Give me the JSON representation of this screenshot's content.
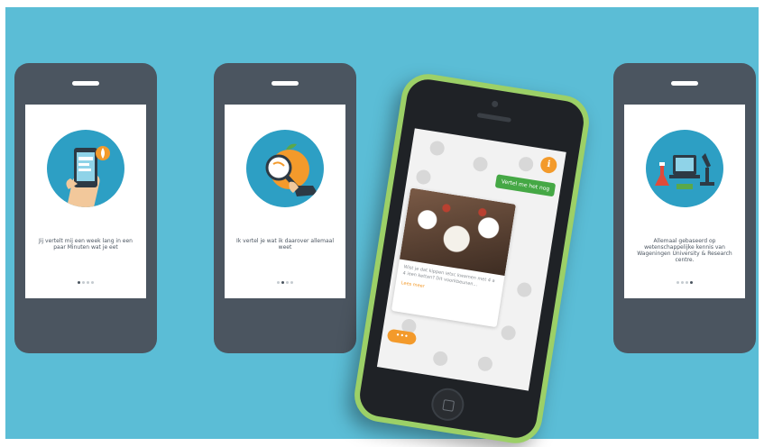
{
  "screens": [
    {
      "caption": "Jij vertelt mij een week lang in een paar Minuten wat je eet",
      "active_dot": 0,
      "dot_count": 4
    },
    {
      "caption": "Ik vertel je wat ik daarover allemaal weet",
      "active_dot": 1,
      "dot_count": 4
    },
    {
      "caption": "Allemaal gebaseerd op wetenschappelijke kennis van Wageningen University & Research centre.",
      "active_dot": 3,
      "dot_count": 4
    }
  ],
  "chat": {
    "info_label": "i",
    "reply_bubble": "Vertel me het nog",
    "message": "Wist je dat kippen ietsc kwamen met 4 a 4 ieen ketten? Dit voorkbeunen...",
    "link": "Lees meer",
    "more_label": "•••"
  },
  "colors": {
    "background": "#5bbdd6",
    "phone_body": "#4b5560",
    "illustration": "#2d9fc4",
    "accent_orange": "#f39a2b",
    "accent_green": "#45a845",
    "phone_frame_green": "#9cd067"
  }
}
